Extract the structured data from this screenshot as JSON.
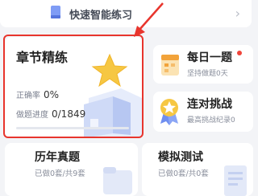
{
  "quick": {
    "label": "快速智能练习",
    "icon": "book-icon"
  },
  "chapter": {
    "title": "章节精练",
    "accuracy_label": "正确率",
    "accuracy_value": "0%",
    "progress_label": "做题进度",
    "progress_value": "0/1849",
    "progress": 0
  },
  "daily": {
    "title": "每日一题",
    "subtitle": "坚持做题0天"
  },
  "streak": {
    "title": "连对挑战",
    "subtitle": "最高挑战纪录0"
  },
  "past": {
    "title": "历年真题",
    "subtitle": "已做0套/共9套"
  },
  "mock": {
    "title": "模拟测试",
    "subtitle": "已做0套/共0套"
  },
  "colors": {
    "highlight": "#e8352d",
    "accent": "#6f8ef0",
    "star": "#f6c743"
  }
}
